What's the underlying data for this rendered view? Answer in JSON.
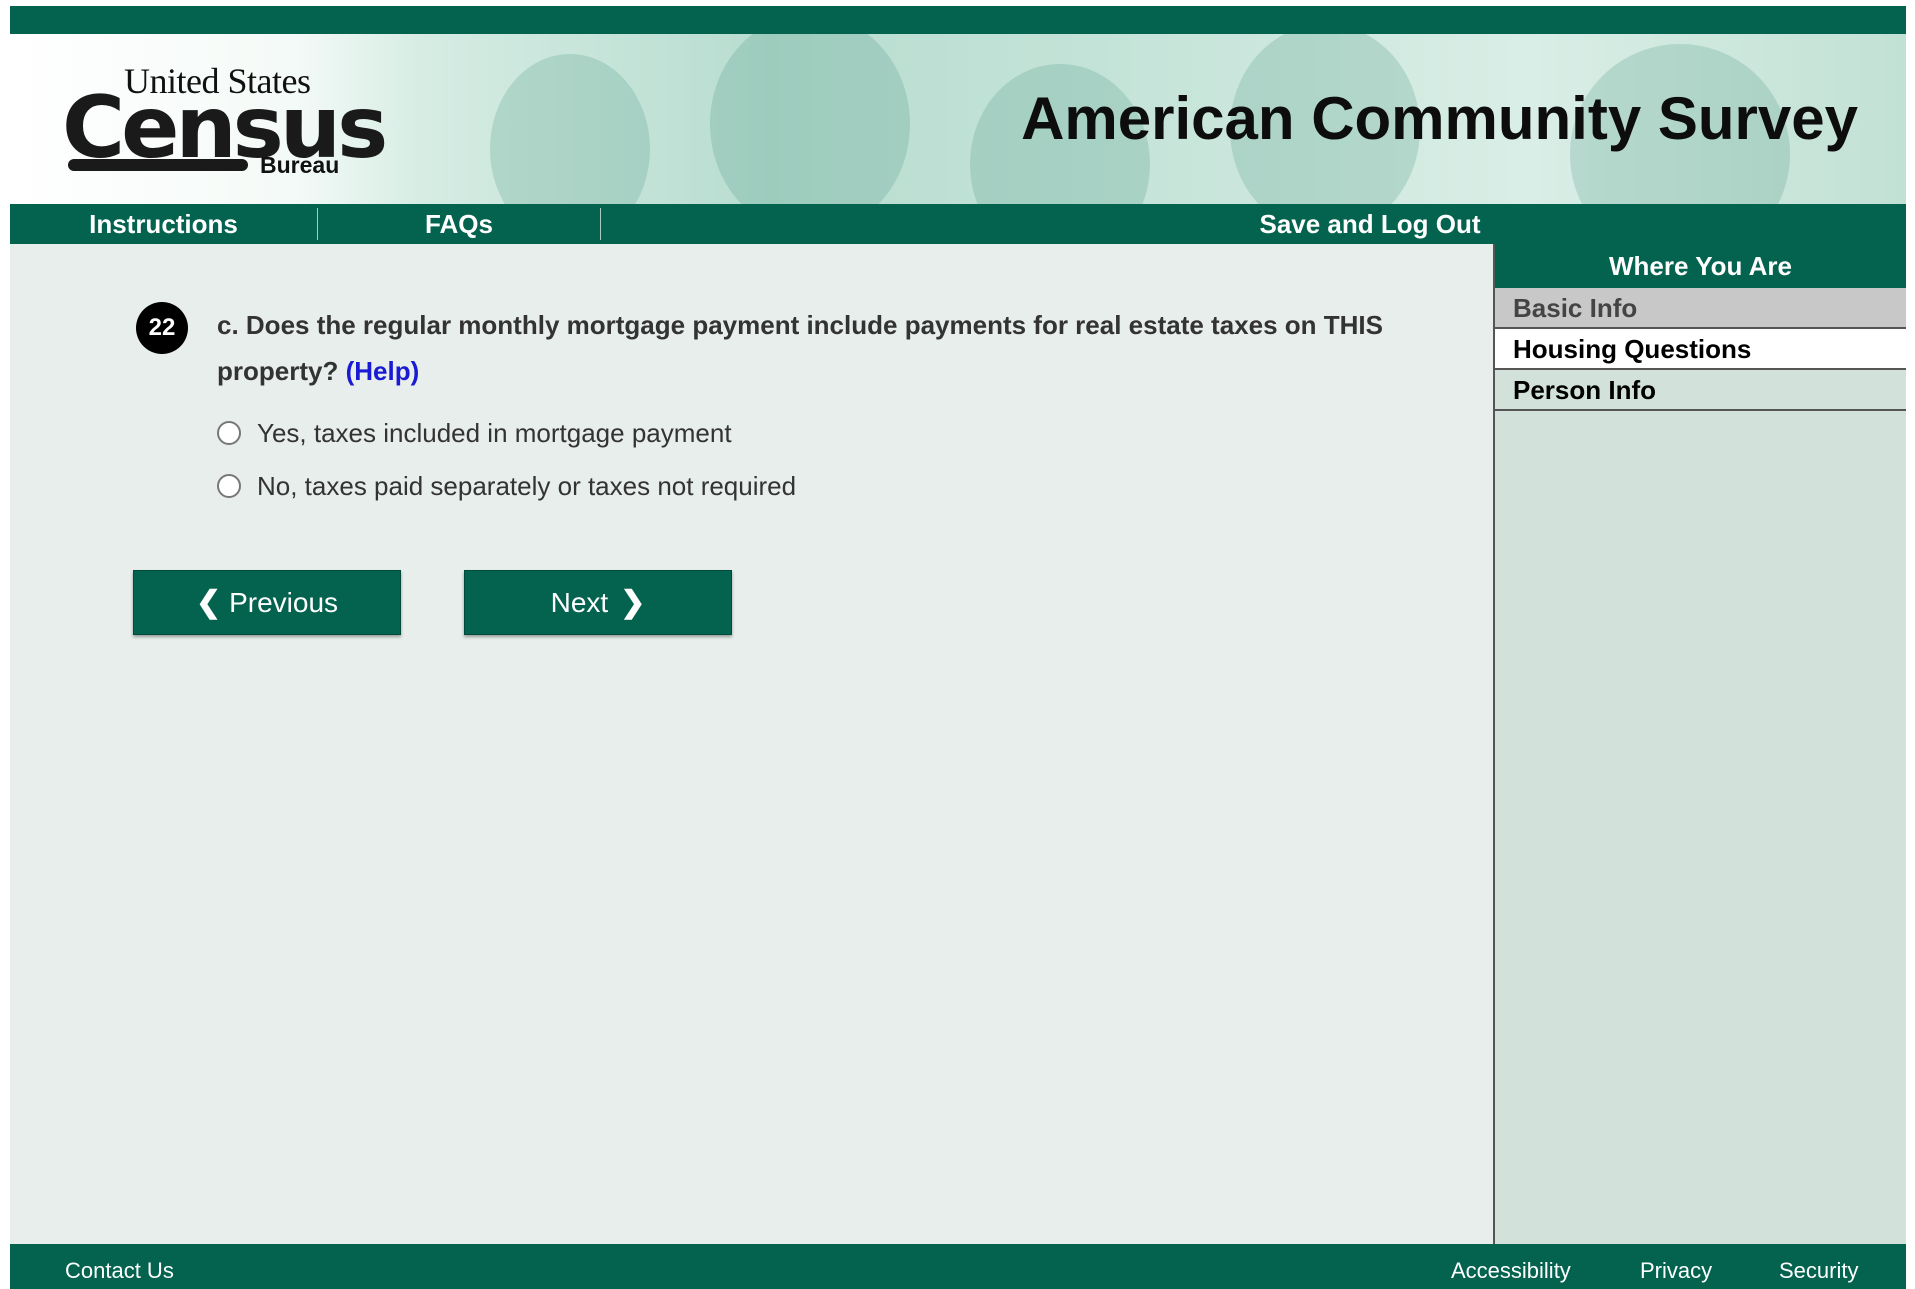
{
  "banner": {
    "logo": {
      "top": "United States",
      "main": "Census",
      "bottom": "Bureau"
    },
    "title": "American Community Survey"
  },
  "nav": {
    "instructions": "Instructions",
    "faqs": "FAQs",
    "save_logout": "Save and Log Out"
  },
  "sidebar": {
    "heading": "Where You Are",
    "items": [
      {
        "label": "Basic Info",
        "state": "visited"
      },
      {
        "label": "Housing Questions",
        "state": "current"
      },
      {
        "label": "Person Info",
        "state": "upcoming"
      }
    ]
  },
  "question": {
    "number": "22",
    "text": "c. Does the regular monthly mortgage payment include payments for real estate taxes on THIS property?",
    "help_label": "(Help)",
    "options": [
      {
        "label": "Yes, taxes included in mortgage payment",
        "selected": false
      },
      {
        "label": "No, taxes paid separately or taxes not required",
        "selected": false
      }
    ]
  },
  "buttons": {
    "previous": "Previous",
    "next": "Next"
  },
  "footer": {
    "contact": "Contact Us",
    "accessibility": "Accessibility",
    "privacy": "Privacy",
    "security": "Security"
  },
  "colors": {
    "brand_green": "#03634f",
    "page_bg": "#e8eeeb",
    "sidebar_bg": "#d2e2da",
    "help_link": "#1a1ad4"
  }
}
